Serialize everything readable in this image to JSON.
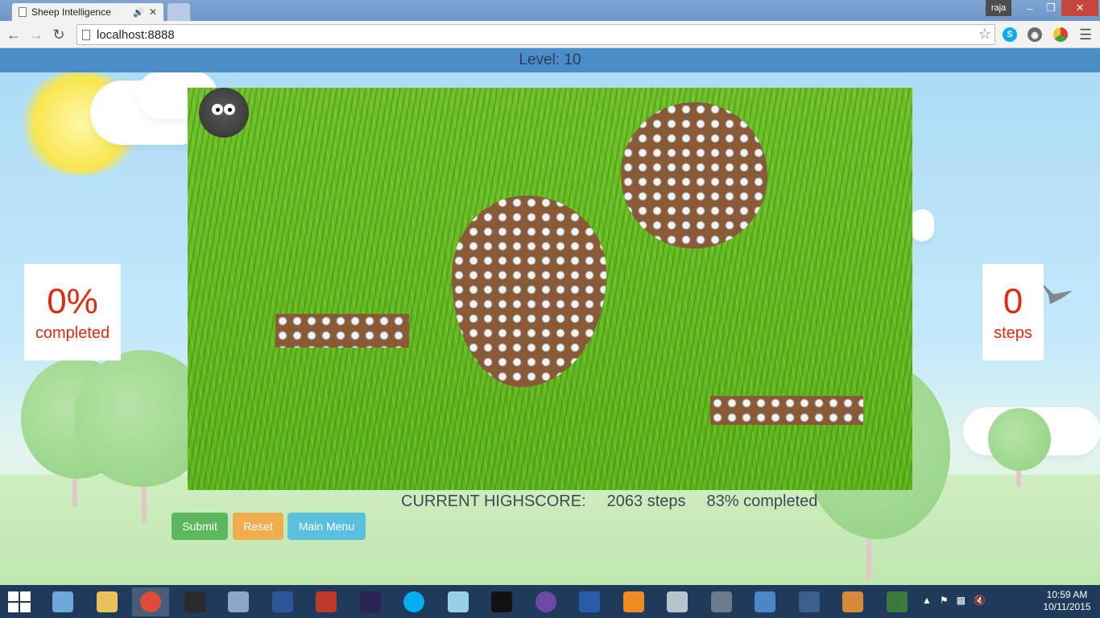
{
  "browser": {
    "tab_title": "Sheep Intelligence",
    "tab_close": "✕",
    "user": "raja",
    "url": "localhost:8888"
  },
  "game": {
    "level_label": "Level: 10",
    "percent_value": "0%",
    "percent_label": "completed",
    "steps_value": "0",
    "steps_label": "steps",
    "highscore_label": "CURRENT HIGHSCORE:",
    "highscore_steps": "2063 steps",
    "highscore_completed": "83% completed"
  },
  "buttons": {
    "submit": "Submit",
    "reset": "Reset",
    "main_menu": "Main Menu"
  },
  "colors": {
    "level_bar": "#4a8ec9",
    "stat_text": "#e02a10",
    "submit": "#5cb85c",
    "reset": "#f0ad4e",
    "main_menu": "#5bc0de"
  },
  "taskbar": {
    "time": "10:59 AM",
    "date": "10/11/2015",
    "apps": [
      "computer-icon",
      "file-explorer-icon",
      "chrome-icon",
      "terminal-icon",
      "network-icon",
      "word-icon",
      "wps-icon",
      "eclipse-icon",
      "skype-icon",
      "notepad-icon",
      "cmd-icon",
      "github-icon",
      "powershell-icon",
      "git-icon",
      "monitor-icon",
      "calculator-icon",
      "remote-desktop-icon",
      "postgres-icon",
      "paint-icon",
      "editor-icon"
    ]
  }
}
